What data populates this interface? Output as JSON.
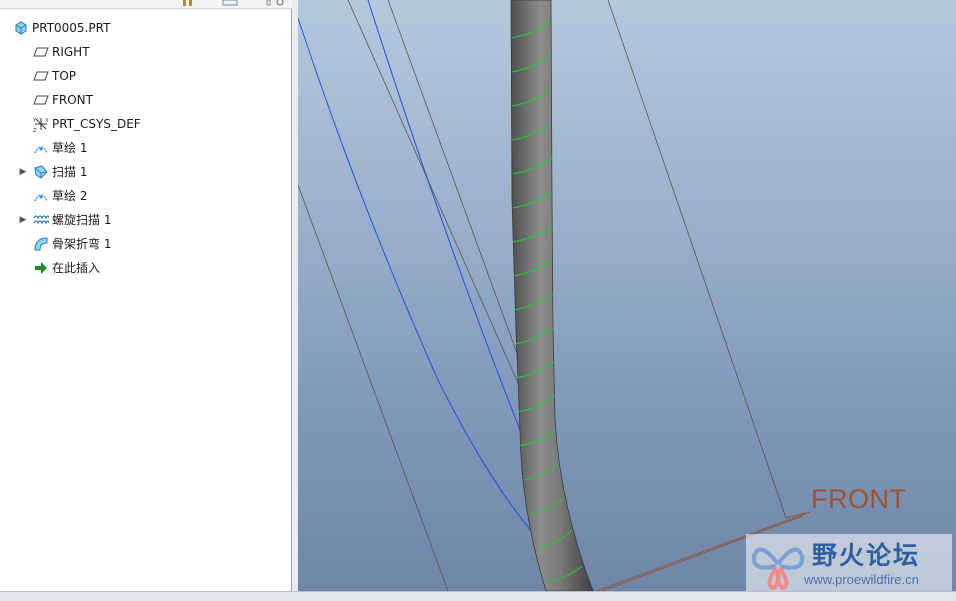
{
  "model_tree": {
    "root": "PRT0005.PRT",
    "items": [
      {
        "label": "RIGHT",
        "icon": "datum-plane-icon",
        "expandable": false
      },
      {
        "label": "TOP",
        "icon": "datum-plane-icon",
        "expandable": false
      },
      {
        "label": "FRONT",
        "icon": "datum-plane-icon",
        "expandable": false
      },
      {
        "label": "PRT_CSYS_DEF",
        "icon": "coordinate-system-icon",
        "expandable": false
      },
      {
        "label": "草绘 1",
        "icon": "sketch-icon",
        "expandable": false
      },
      {
        "label": "扫描 1",
        "icon": "sweep-icon",
        "expandable": true
      },
      {
        "label": "草绘 2",
        "icon": "sketch-icon",
        "expandable": false
      },
      {
        "label": "螺旋扫描 1",
        "icon": "helical-sweep-icon",
        "expandable": true
      },
      {
        "label": "骨架折弯 1",
        "icon": "spinal-bend-icon",
        "expandable": false
      },
      {
        "label": "在此插入",
        "icon": "insert-here-arrow-icon",
        "expandable": false
      }
    ]
  },
  "viewport": {
    "datum_label": "FRONT"
  },
  "watermark": {
    "title": "野火论坛",
    "url": "www.proewildfire.cn"
  },
  "colors": {
    "datum_label": "#a0522d",
    "curve_blue": "#1f4fe0",
    "helix_green": "#22c83a",
    "model_gray": "#6e6e6e"
  }
}
